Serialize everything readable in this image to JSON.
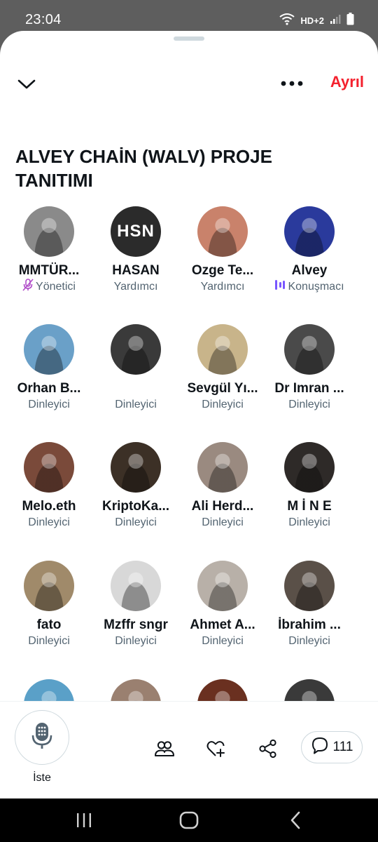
{
  "status": {
    "time": "23:04",
    "network": "HD+2"
  },
  "header": {
    "leave_label": "Ayrıl"
  },
  "space": {
    "title": "ALVEY CHAİN (WALV) PROJE TANITIMI"
  },
  "participants": [
    {
      "name": "MMTÜR...",
      "role": "Yönetici",
      "role_icon": "mic-off-icon",
      "avatar_color": "#8a8a8a"
    },
    {
      "name": "HASAN",
      "role": "Yardımcı",
      "avatar_text": "HSN",
      "avatar_color": "#2b2b2b"
    },
    {
      "name": "Ozge Te...",
      "role": "Yardımcı",
      "avatar_color": "#c9826b"
    },
    {
      "name": "Alvey",
      "role": "Konuşmacı",
      "role_icon": "speaking-bars-icon",
      "avatar_color": "#2a3a9c"
    },
    {
      "name": "Orhan B...",
      "role": "Dinleyici",
      "avatar_color": "#6aa0c8"
    },
    {
      "name": "",
      "role": "Dinleyici",
      "avatar_color": "#3a3a3a"
    },
    {
      "name": "Sevgül Yı...",
      "role": "Dinleyici",
      "avatar_color": "#c8b48a"
    },
    {
      "name": "Dr Imran ...",
      "role": "Dinleyici",
      "avatar_color": "#4a4a4a"
    },
    {
      "name": "Melo.eth",
      "role": "Dinleyici",
      "avatar_color": "#7a4a3a"
    },
    {
      "name": "KriptoKa...",
      "role": "Dinleyici",
      "avatar_color": "#3c3026"
    },
    {
      "name": "Ali Herd...",
      "role": "Dinleyici",
      "avatar_color": "#9a8a80"
    },
    {
      "name": "M İ N E",
      "role": "Dinleyici",
      "avatar_color": "#2e2a28"
    },
    {
      "name": "fato",
      "role": "Dinleyici",
      "avatar_color": "#a08a6a"
    },
    {
      "name": "Mzffr sngr",
      "role": "Dinleyici",
      "avatar_color": "#d8d8d8"
    },
    {
      "name": "Ahmet A...",
      "role": "Dinleyici",
      "avatar_color": "#b8b0a8"
    },
    {
      "name": "İbrahim ...",
      "role": "Dinleyici",
      "avatar_color": "#5a5048"
    },
    {
      "name": "",
      "role": "",
      "avatar_color": "#5aa0c8"
    },
    {
      "name": "",
      "role": "",
      "avatar_color": "#9a8070"
    },
    {
      "name": "",
      "role": "",
      "avatar_color": "#6a3020"
    },
    {
      "name": "",
      "role": "",
      "avatar_color": "#3a3a3a"
    }
  ],
  "bottom": {
    "mic_label": "İste",
    "comment_count": "111"
  }
}
